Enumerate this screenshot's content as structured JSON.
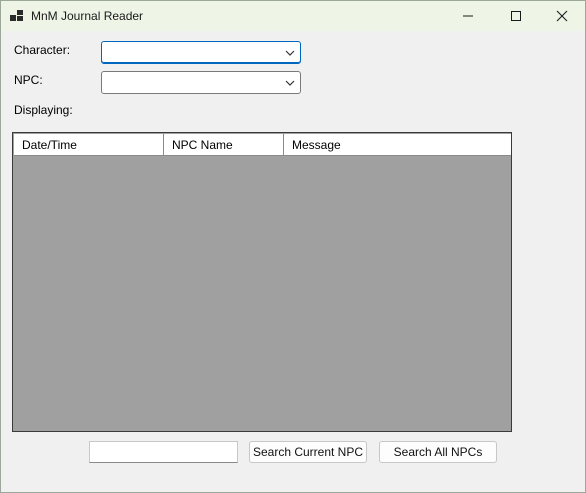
{
  "window": {
    "title": "MnM Journal Reader",
    "icons": {
      "app": "app-icon",
      "minimize": "minimize-icon",
      "maximize": "maximize-icon",
      "close": "close-icon"
    }
  },
  "form": {
    "character_label": "Character:",
    "character_value": "",
    "npc_label": "NPC:",
    "npc_value": "",
    "displaying_label": "Displaying:"
  },
  "grid": {
    "columns": [
      "Date/Time",
      "NPC Name",
      "Message"
    ],
    "rows": []
  },
  "search": {
    "input_value": "",
    "search_current_label": "Search Current NPC",
    "search_all_label": "Search All NPCs"
  },
  "colors": {
    "accent": "#0067c0",
    "grid_background": "#a0a0a0",
    "titlebar": "#eef4e6"
  }
}
